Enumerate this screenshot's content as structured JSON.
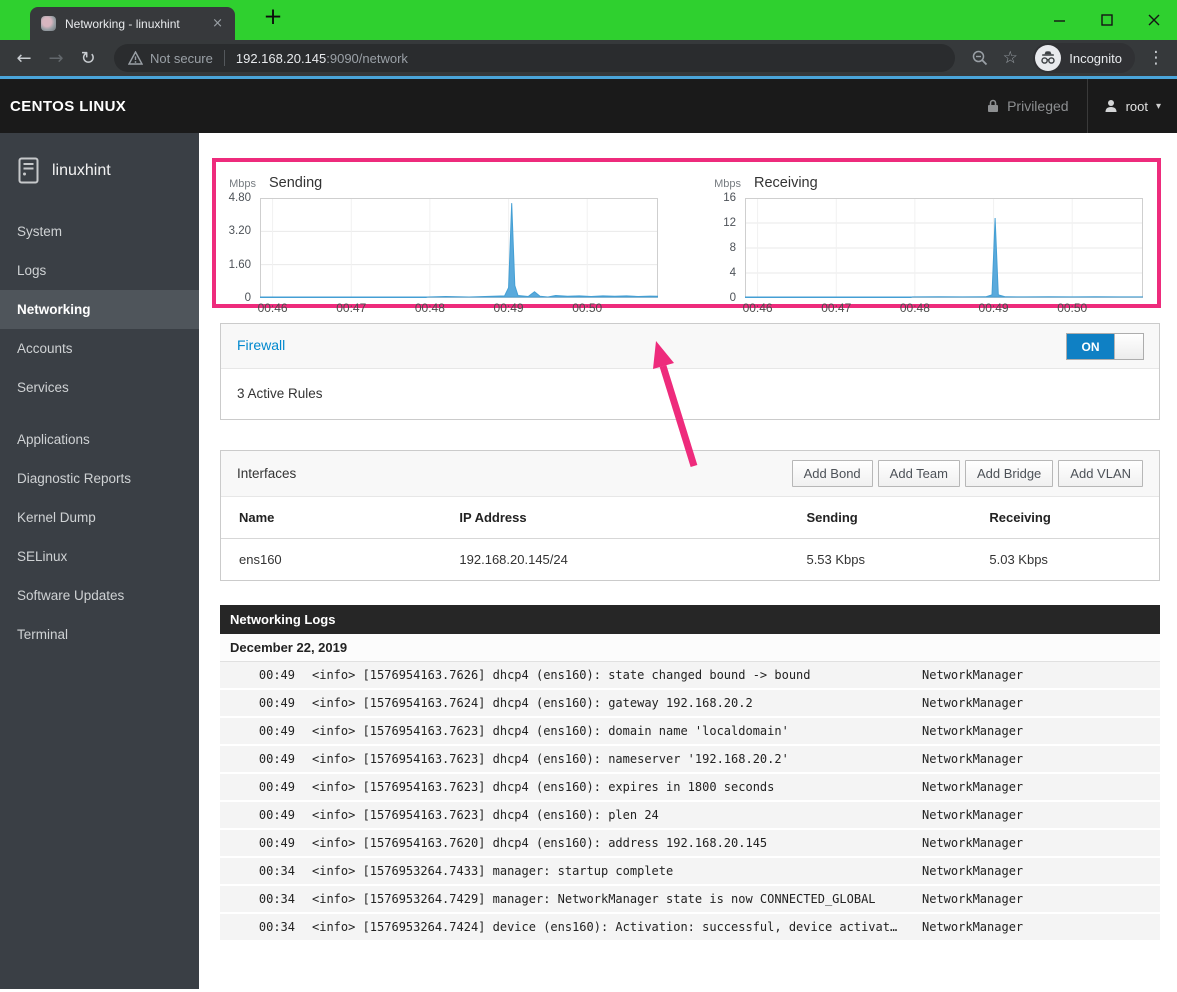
{
  "browser": {
    "tab_title": "Networking - linuxhint",
    "tab_close": "×",
    "new_tab": "+",
    "back": "←",
    "forward": "→",
    "reload": "↻",
    "security_label": "Not secure",
    "url_host": "192.168.20.145",
    "url_path": ":9090/network",
    "star": "☆",
    "incognito_label": "Incognito",
    "menu": "⋮",
    "window_controls": [
      "minimize",
      "maximize",
      "close"
    ]
  },
  "header": {
    "brand": "CENTOS LINUX",
    "privileged": "Privileged",
    "user": "root",
    "caret": "▾"
  },
  "sidebar": {
    "hostname": "linuxhint",
    "active": "Networking",
    "groups": [
      {
        "items": [
          "System",
          "Logs",
          "Networking",
          "Accounts",
          "Services"
        ]
      },
      {
        "items": [
          "Applications",
          "Diagnostic Reports",
          "Kernel Dump",
          "SELinux",
          "Software Updates",
          "Terminal"
        ]
      }
    ]
  },
  "chart_data": [
    {
      "type": "area",
      "title": "Sending",
      "unit": "Mbps",
      "x_ticks": [
        "00:46",
        "00:47",
        "00:48",
        "00:49",
        "00:50"
      ],
      "y_ticks": [
        "4.80",
        "3.20",
        "1.60",
        "0"
      ],
      "ylim": [
        0,
        4.8
      ],
      "x_domain_minutes": [
        -0.16,
        4.9
      ],
      "grid": true,
      "points": [
        [
          -0.16,
          0
        ],
        [
          1.93,
          0
        ],
        [
          1.97,
          0.05
        ],
        [
          2.2,
          0.07
        ],
        [
          2.5,
          0.05
        ],
        [
          2.8,
          0.08
        ],
        [
          2.95,
          0.1
        ],
        [
          3.0,
          0.5
        ],
        [
          3.04,
          4.55
        ],
        [
          3.08,
          0.6
        ],
        [
          3.12,
          0.12
        ],
        [
          3.25,
          0.07
        ],
        [
          3.33,
          0.3
        ],
        [
          3.4,
          0.08
        ],
        [
          3.5,
          0.05
        ],
        [
          3.6,
          0.12
        ],
        [
          3.75,
          0.08
        ],
        [
          3.9,
          0.1
        ],
        [
          4.05,
          0.07
        ],
        [
          4.2,
          0.1
        ],
        [
          4.35,
          0.08
        ],
        [
          4.5,
          0.1
        ],
        [
          4.65,
          0.07
        ],
        [
          4.8,
          0.09
        ],
        [
          4.9,
          0.08
        ]
      ]
    },
    {
      "type": "area",
      "title": "Receiving",
      "unit": "Mbps",
      "x_ticks": [
        "00:46",
        "00:47",
        "00:48",
        "00:49",
        "00:50"
      ],
      "y_ticks": [
        "16",
        "12",
        "8",
        "4",
        "0"
      ],
      "ylim": [
        0,
        16
      ],
      "x_domain_minutes": [
        -0.16,
        4.9
      ],
      "grid": true,
      "points": [
        [
          -0.16,
          0
        ],
        [
          1.93,
          0
        ],
        [
          1.97,
          0.18
        ],
        [
          2.3,
          0.2
        ],
        [
          2.6,
          0.17
        ],
        [
          2.9,
          0.2
        ],
        [
          2.98,
          0.5
        ],
        [
          3.02,
          12.8
        ],
        [
          3.06,
          0.5
        ],
        [
          3.15,
          0.2
        ],
        [
          3.4,
          0.18
        ],
        [
          3.7,
          0.2
        ],
        [
          4.0,
          0.17
        ],
        [
          4.3,
          0.2
        ],
        [
          4.6,
          0.18
        ],
        [
          4.9,
          0.18
        ]
      ]
    }
  ],
  "firewall": {
    "title": "Firewall",
    "toggle_state": "ON",
    "body": "3 Active Rules"
  },
  "interfaces": {
    "title": "Interfaces",
    "buttons": [
      "Add Bond",
      "Add Team",
      "Add Bridge",
      "Add VLAN"
    ],
    "columns": [
      "Name",
      "IP Address",
      "Sending",
      "Receiving"
    ],
    "rows": [
      [
        "ens160",
        "192.168.20.145/24",
        "5.53 Kbps",
        "5.03 Kbps"
      ]
    ]
  },
  "logs": {
    "title": "Networking Logs",
    "date": "December 22, 2019",
    "entries": [
      {
        "time": "00:49",
        "message": "<info> [1576954163.7626] dhcp4 (ens160): state changed bound -> bound",
        "service": "NetworkManager"
      },
      {
        "time": "00:49",
        "message": "<info> [1576954163.7624] dhcp4 (ens160): gateway 192.168.20.2",
        "service": "NetworkManager"
      },
      {
        "time": "00:49",
        "message": "<info> [1576954163.7623] dhcp4 (ens160): domain name 'localdomain'",
        "service": "NetworkManager"
      },
      {
        "time": "00:49",
        "message": "<info> [1576954163.7623] dhcp4 (ens160): nameserver '192.168.20.2'",
        "service": "NetworkManager"
      },
      {
        "time": "00:49",
        "message": "<info> [1576954163.7623] dhcp4 (ens160): expires in 1800 seconds",
        "service": "NetworkManager"
      },
      {
        "time": "00:49",
        "message": "<info> [1576954163.7623] dhcp4 (ens160): plen 24",
        "service": "NetworkManager"
      },
      {
        "time": "00:49",
        "message": "<info> [1576954163.7620] dhcp4 (ens160): address 192.168.20.145",
        "service": "NetworkManager"
      },
      {
        "time": "00:34",
        "message": "<info> [1576953264.7433] manager: startup complete",
        "service": "NetworkManager"
      },
      {
        "time": "00:34",
        "message": "<info> [1576953264.7429] manager: NetworkManager state is now CONNECTED_GLOBAL",
        "service": "NetworkManager"
      },
      {
        "time": "00:34",
        "message": "<info> [1576953264.7424] device (ens160): Activation: successful, device activat…",
        "service": "NetworkManager"
      }
    ]
  },
  "colors": {
    "highlight_pink": "#ee2b7c",
    "chart_fill": "#5aaadc",
    "chart_stroke": "#449fd4",
    "link_blue": "#0088ce",
    "toggle_on_blue": "#0f80c4",
    "chrome_green": "#2fd02f",
    "toolbar_accent_blue": "#4aa5da"
  }
}
